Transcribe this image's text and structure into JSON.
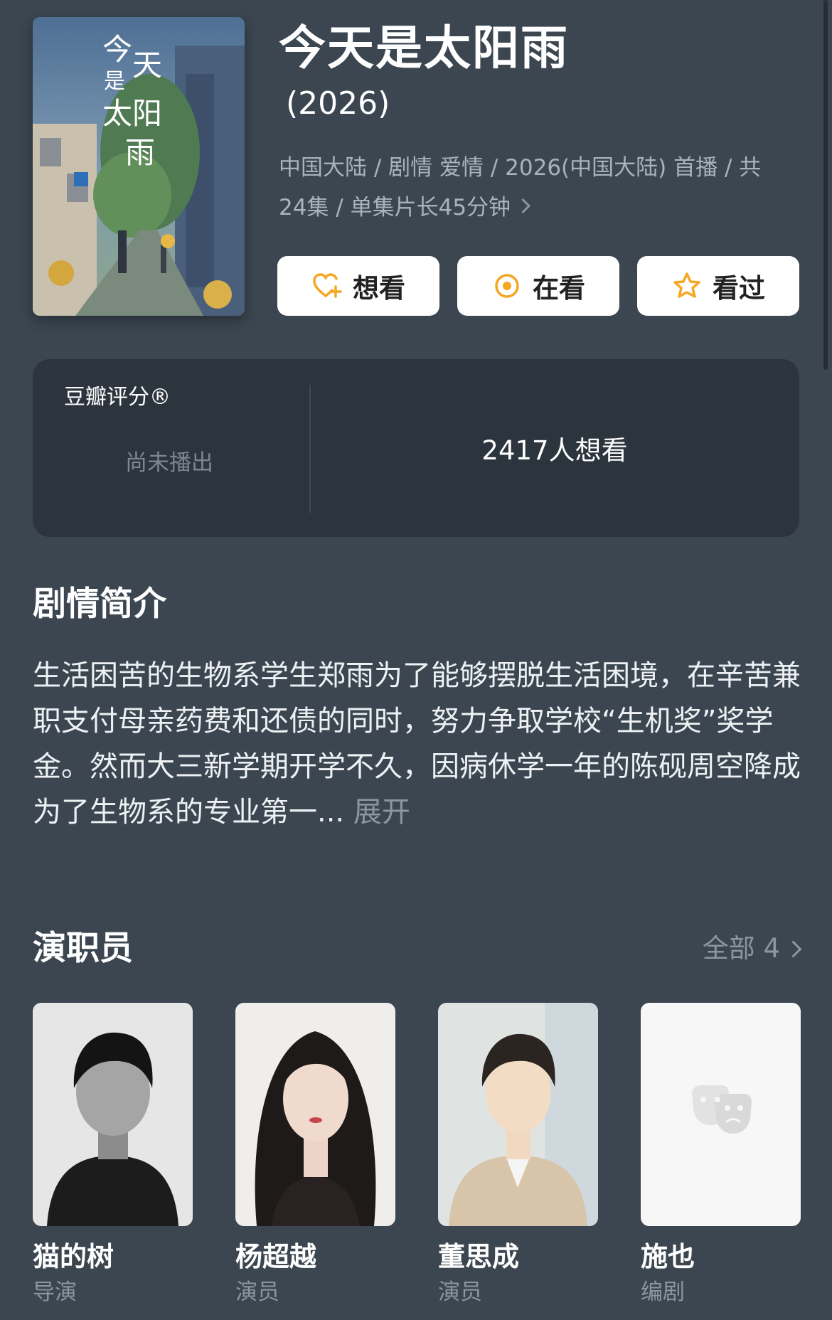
{
  "show": {
    "title": "今天是太阳雨",
    "year": "(2026)",
    "meta": "中国大陆 / 剧情 爱情 / 2026(中国大陆) 首播 / 共24集 / 单集片长45分钟",
    "poster_text": "今天是太阳雨"
  },
  "actions": [
    {
      "label": "想看",
      "icon": "heart-plus-icon"
    },
    {
      "label": "在看",
      "icon": "dot-circle-icon"
    },
    {
      "label": "看过",
      "icon": "star-icon"
    }
  ],
  "rating": {
    "label": "豆瓣评分®",
    "status": "尚未播出",
    "wish_count": "2417人想看"
  },
  "synopsis": {
    "title": "剧情简介",
    "text": "生活困苦的生物系学生郑雨为了能够摆脱生活困境，在辛苦兼职支付母亲药费和还债的同时，努力争取学校“生机奖”奖学金。然而大三新学期开学不久，因病休学一年的陈砚周空降成为了生物系的专业第一...",
    "expand_label": "展开"
  },
  "cast": {
    "title": "演职员",
    "view_all_label": "全部 4",
    "members": [
      {
        "name": "猫的树",
        "role": "导演"
      },
      {
        "name": "杨超越",
        "role": "演员"
      },
      {
        "name": "董思成",
        "role": "演员"
      },
      {
        "name": "施也",
        "role": "编剧"
      }
    ]
  },
  "colors": {
    "background": "#3b4650",
    "card": "#2c353e",
    "accent": "#f5a623",
    "muted_text": "#8c969f"
  }
}
